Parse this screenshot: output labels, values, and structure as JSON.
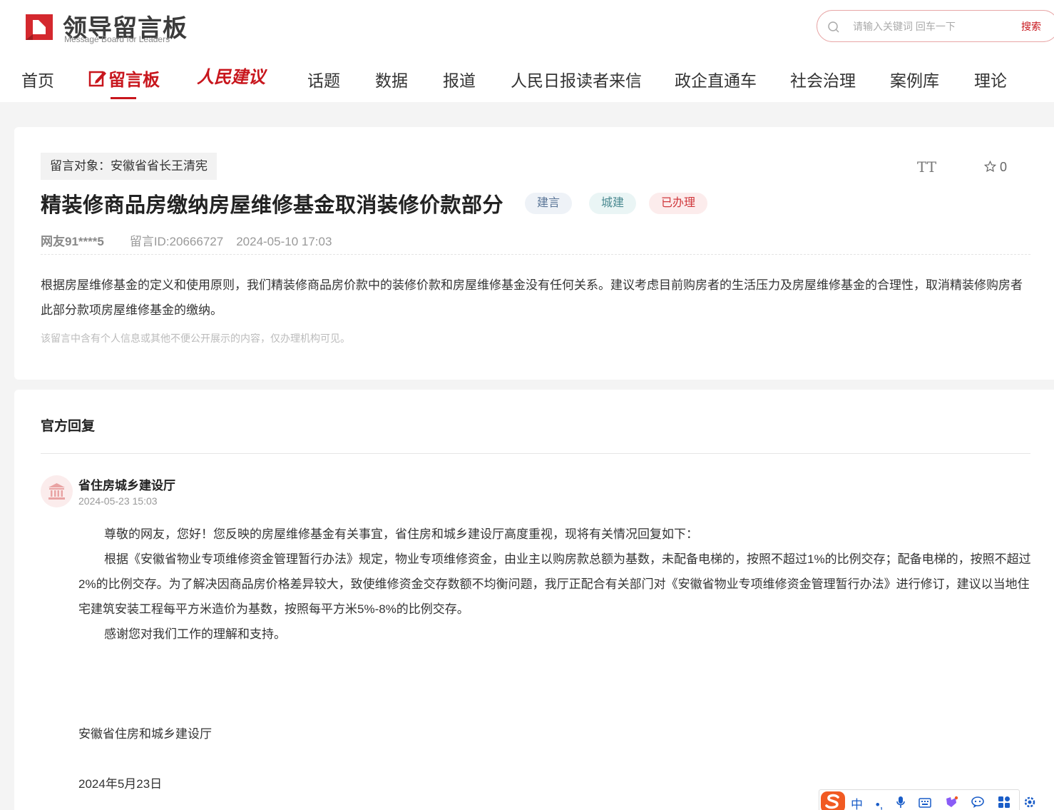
{
  "brand": {
    "title": "领导留言板",
    "subtitle": "Message Board for Leaders"
  },
  "search": {
    "placeholder": "请输入关键词 回车一下",
    "button": "搜索"
  },
  "nav": {
    "home": "首页",
    "message_board": "留言板",
    "people_suggest": "人民建议",
    "topics": "话题",
    "data": "数据",
    "reports": "报道",
    "readers_letters": "人民日报读者来信",
    "gov_direct": "政企直通车",
    "social_governance": "社会治理",
    "case_library": "案例库",
    "theory": "理论"
  },
  "message": {
    "target": "留言对象：安徽省省长王清宪",
    "font_size_icon": "TT",
    "favorites": "0",
    "title": "精装修商品房缴纳房屋维修基金取消装修价款部分",
    "tags": [
      "建言",
      "城建",
      "已办理"
    ],
    "author": "网友91****5",
    "message_id": "留言ID:20666727",
    "datetime": "2024-05-10 17:03",
    "body": "根据房屋维修基金的定义和使用原则，我们精装修商品房价款中的装修价款和房屋维修基金没有任何关系。建议考虑目前购房者的生活压力及房屋维修基金的合理性，取消精装修购房者此部分款项房屋维修基金的缴纳。",
    "privacy_notice": "该留言中含有个人信息或其他不便公开展示的内容，仅办理机构可见。"
  },
  "reply": {
    "heading": "官方回复",
    "org": "省住房城乡建设厅",
    "datetime": "2024-05-23 15:03",
    "paragraphs": [
      "尊敬的网友，您好！您反映的房屋维修基金有关事宜，省住房和城乡建设厅高度重视，现将有关情况回复如下：",
      "根据《安徽省物业专项维修资金管理暂行办法》规定，物业专项维修资金，由业主以购房款总额为基数，未配备电梯的，按照不超过1%的比例交存；配备电梯的，按照不超过2%的比例交存。为了解决因商品房价格差异较大，致使维修资金交存数额不均衡问题，我厅正配合有关部门对《安徽省物业专项维修资金管理暂行办法》进行修订，建议以当地住宅建筑安装工程每平方米造价为基数，按照每平方米5%-8%的比例交存。",
      "感谢您对我们工作的理解和支持。"
    ],
    "signature": "安徽省住房和城乡建设厅",
    "sign_date": "2024年5月23日"
  },
  "ime": {
    "mode": "中",
    "punct": "•,"
  },
  "colors": {
    "brand_red": "#c8161d",
    "tag_blue": "#5a7597",
    "tag_green": "#4b8a91",
    "tag_red": "#d0393d"
  }
}
